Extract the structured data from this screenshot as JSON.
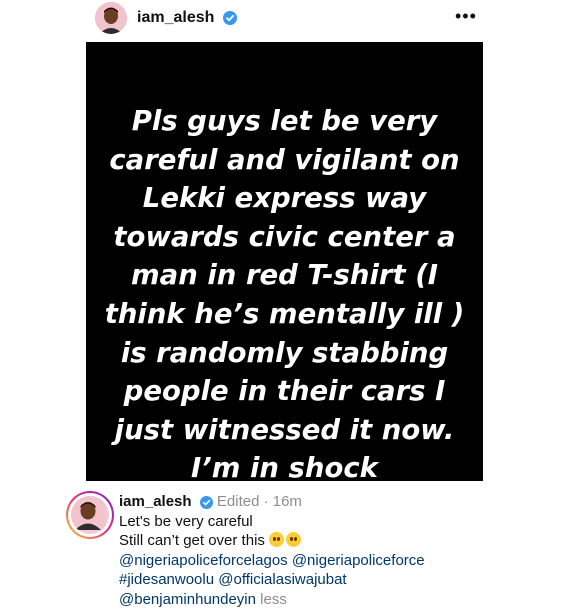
{
  "header": {
    "username": "iam_alesh",
    "more_label": "•••"
  },
  "post": {
    "lines": [
      "Pls guys let be very",
      "careful and vigilant on",
      "Lekki express way",
      "towards civic center a",
      "man in red T-shirt (I",
      "think he’s mentally ill )",
      "is randomly stabbing",
      "people in their cars I",
      "just witnessed it now.",
      "I’m in shock"
    ]
  },
  "caption": {
    "username": "iam_alesh",
    "meta": "Edited · 16m",
    "line1": "Let's be very careful",
    "line2": "Still can’t get over this",
    "mention1": "@nigeriapoliceforcelagos",
    "mention2": "@nigeriapoliceforce",
    "hashtag": "#jidesanwoolu",
    "mention3": "@officialasiwajubat",
    "mention4": "@benjaminhundeyin",
    "less_label": "less"
  },
  "colors": {
    "verified": "#3897f0",
    "link": "#00376b",
    "meta": "#8e8e8e",
    "emoji": "#ffcc33"
  },
  "icons": [
    "verified-badge-icon",
    "more-options-icon",
    "pleading-face-emoji-icon"
  ]
}
